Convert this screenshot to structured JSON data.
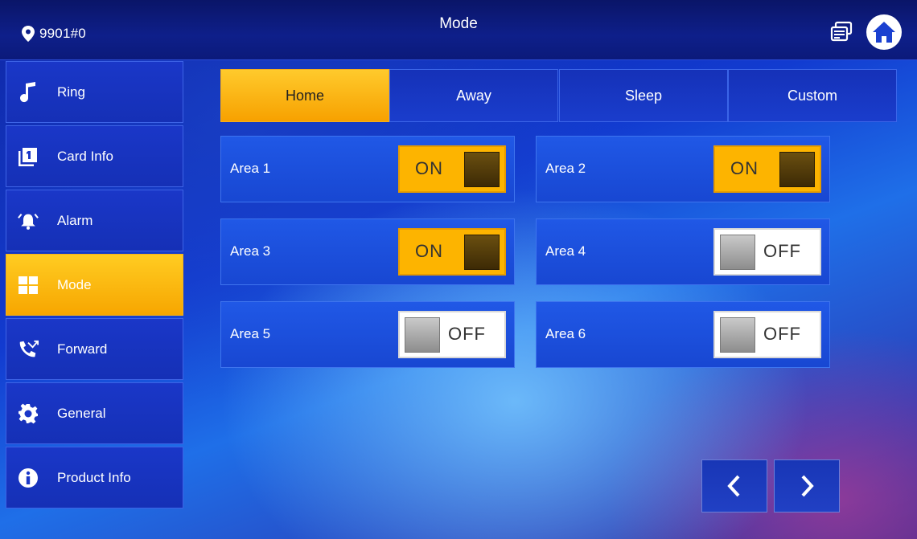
{
  "header": {
    "location": "9901#0",
    "title": "Mode"
  },
  "sidebar": {
    "items": [
      {
        "label": "Ring",
        "icon": "music-note-icon",
        "active": false
      },
      {
        "label": "Card Info",
        "icon": "card-icon",
        "active": false
      },
      {
        "label": "Alarm",
        "icon": "alarm-icon",
        "active": false
      },
      {
        "label": "Mode",
        "icon": "mode-grid-icon",
        "active": true
      },
      {
        "label": "Forward",
        "icon": "call-forward-icon",
        "active": false
      },
      {
        "label": "General",
        "icon": "gear-icon",
        "active": false
      },
      {
        "label": "Product Info",
        "icon": "info-icon",
        "active": false
      }
    ]
  },
  "tabs": [
    {
      "label": "Home",
      "active": true
    },
    {
      "label": "Away",
      "active": false
    },
    {
      "label": "Sleep",
      "active": false
    },
    {
      "label": "Custom",
      "active": false
    }
  ],
  "areas": [
    {
      "label": "Area 1",
      "state": "ON"
    },
    {
      "label": "Area 2",
      "state": "ON"
    },
    {
      "label": "Area 3",
      "state": "ON"
    },
    {
      "label": "Area 4",
      "state": "OFF"
    },
    {
      "label": "Area 5",
      "state": "OFF"
    },
    {
      "label": "Area 6",
      "state": "OFF"
    }
  ],
  "colors": {
    "accent": "#fdb400",
    "panel": "#1847d2",
    "header": "#0e1f8a"
  }
}
